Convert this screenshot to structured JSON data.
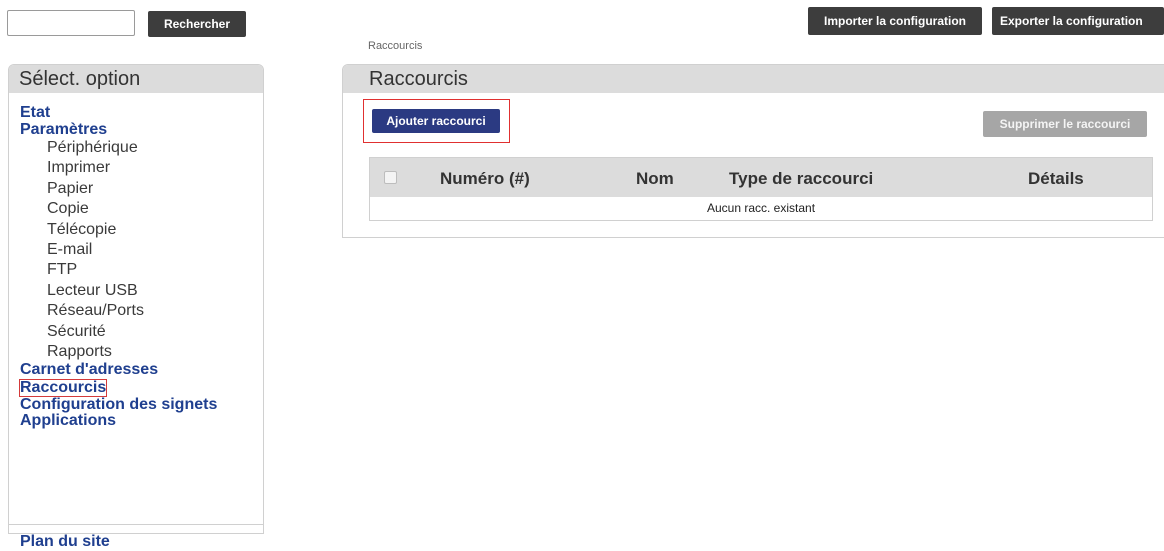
{
  "search": {
    "placeholder": "",
    "value": "",
    "button_label": "Rechercher"
  },
  "toolbar": {
    "import_label": "Importer la configuration",
    "export_label": "Exporter la configuration"
  },
  "breadcrumb": "Raccourcis",
  "sidebar": {
    "title": "Sélect. option",
    "items": [
      {
        "label": "Etat",
        "level": "top"
      },
      {
        "label": "Paramètres",
        "level": "top"
      },
      {
        "label": "Périphérique",
        "level": "sub"
      },
      {
        "label": "Imprimer",
        "level": "sub"
      },
      {
        "label": "Papier",
        "level": "sub"
      },
      {
        "label": "Copie",
        "level": "sub"
      },
      {
        "label": "Télécopie",
        "level": "sub"
      },
      {
        "label": "E-mail",
        "level": "sub"
      },
      {
        "label": "FTP",
        "level": "sub"
      },
      {
        "label": "Lecteur USB",
        "level": "sub"
      },
      {
        "label": "Réseau/Ports",
        "level": "sub"
      },
      {
        "label": "Sécurité",
        "level": "sub"
      },
      {
        "label": "Rapports",
        "level": "sub"
      },
      {
        "label": "Carnet d'adresses",
        "level": "top"
      },
      {
        "label": "Raccourcis",
        "level": "top",
        "active": true
      },
      {
        "label": "Configuration des signets",
        "level": "top"
      },
      {
        "label": "Applications",
        "level": "top"
      }
    ],
    "sitemap_label": "Plan du site"
  },
  "main": {
    "title": "Raccourcis",
    "add_label": "Ajouter raccourci",
    "delete_label": "Supprimer le raccourci",
    "table": {
      "columns": [
        "Numéro (#)",
        "Nom",
        "Type de raccourci",
        "Détails"
      ],
      "empty_text": "Aucun racc. existant"
    }
  },
  "colors": {
    "primary_button": "#2b3a82",
    "dark_button": "#3d3d3d",
    "disabled_button": "#a6a6a6",
    "nav_link": "#1f3f8f",
    "highlight_border": "#e03030",
    "header_bg": "#dcdcdc"
  }
}
